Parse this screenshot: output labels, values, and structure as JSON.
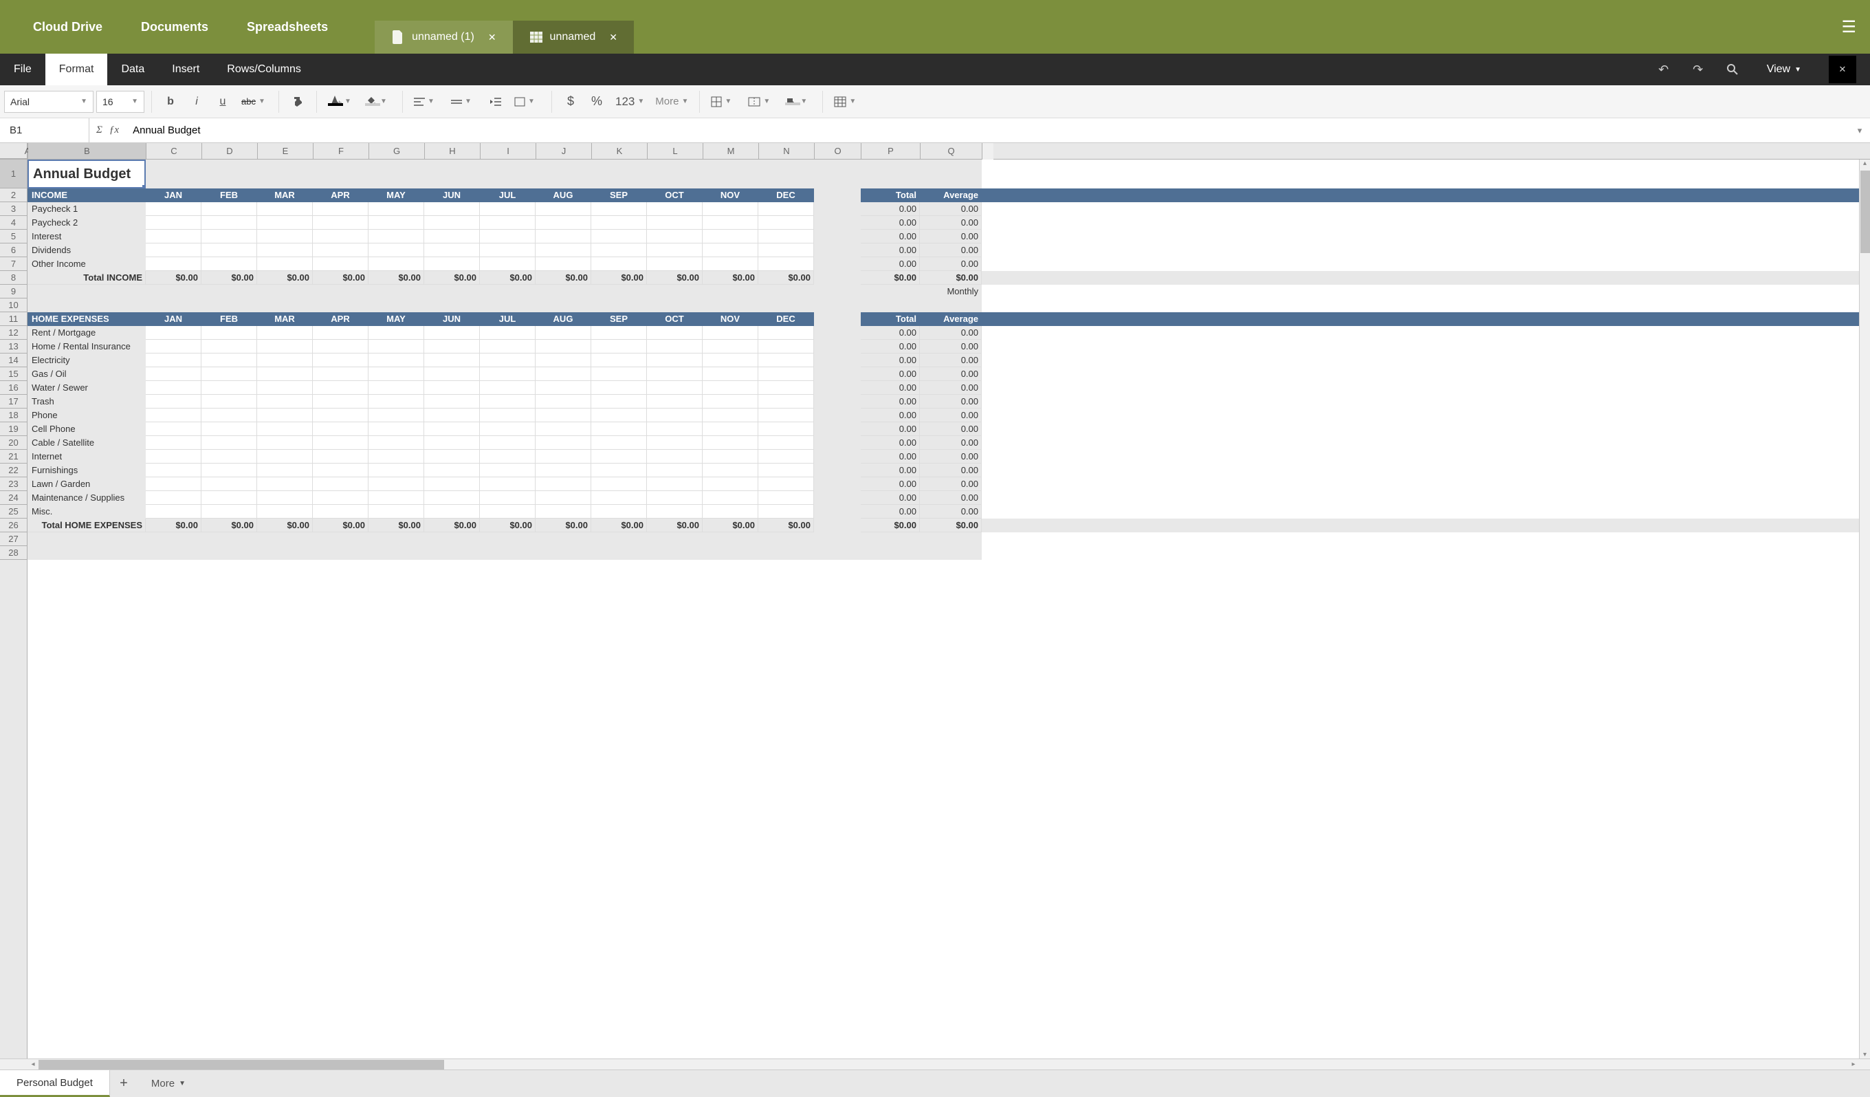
{
  "header": {
    "nav": [
      "Cloud Drive",
      "Documents",
      "Spreadsheets"
    ],
    "tabs": [
      {
        "label": "unnamed (1)",
        "type": "doc",
        "active": false
      },
      {
        "label": "unnamed",
        "type": "sheet",
        "active": true
      }
    ]
  },
  "menubar": {
    "items": [
      "File",
      "Format",
      "Data",
      "Insert",
      "Rows/Columns"
    ],
    "active": "Format",
    "view": "View"
  },
  "toolbar": {
    "font": "Arial",
    "size": "16",
    "num_fmt": "123",
    "more": "More"
  },
  "formula_bar": {
    "cell_ref": "B1",
    "formula": "Annual Budget"
  },
  "columns": [
    "A",
    "B",
    "C",
    "D",
    "E",
    "F",
    "G",
    "H",
    "I",
    "J",
    "K",
    "L",
    "M",
    "N",
    "O",
    "P",
    "Q"
  ],
  "months": [
    "JAN",
    "FEB",
    "MAR",
    "APR",
    "MAY",
    "JUN",
    "JUL",
    "AUG",
    "SEP",
    "OCT",
    "NOV",
    "DEC"
  ],
  "summary_headers": {
    "total": "Total",
    "average": "Average"
  },
  "rows": [
    {
      "n": 1,
      "type": "title",
      "b": "Annual Budget"
    },
    {
      "n": 2,
      "type": "section",
      "b": "INCOME",
      "months": true,
      "summary": true
    },
    {
      "n": 3,
      "type": "item",
      "b": "Paycheck 1",
      "tot": "0.00",
      "avg": "0.00"
    },
    {
      "n": 4,
      "type": "item",
      "b": "Paycheck 2",
      "tot": "0.00",
      "avg": "0.00"
    },
    {
      "n": 5,
      "type": "item",
      "b": "Interest",
      "tot": "0.00",
      "avg": "0.00"
    },
    {
      "n": 6,
      "type": "item",
      "b": "Dividends",
      "tot": "0.00",
      "avg": "0.00"
    },
    {
      "n": 7,
      "type": "item",
      "b": "Other Income",
      "tot": "0.00",
      "avg": "0.00"
    },
    {
      "n": 8,
      "type": "total",
      "b": "Total INCOME",
      "vals": [
        "$0.00",
        "$0.00",
        "$0.00",
        "$0.00",
        "$0.00",
        "$0.00",
        "$0.00",
        "$0.00",
        "$0.00",
        "$0.00",
        "$0.00",
        "$0.00"
      ],
      "tot": "$0.00",
      "avg": "$0.00"
    },
    {
      "n": 9,
      "type": "blank",
      "avg": "Monthly"
    },
    {
      "n": 10,
      "type": "blank"
    },
    {
      "n": 11,
      "type": "section",
      "b": "HOME EXPENSES",
      "months": true,
      "summary": true
    },
    {
      "n": 12,
      "type": "item",
      "b": "Rent / Mortgage",
      "tot": "0.00",
      "avg": "0.00"
    },
    {
      "n": 13,
      "type": "item",
      "b": "Home / Rental Insurance",
      "tot": "0.00",
      "avg": "0.00"
    },
    {
      "n": 14,
      "type": "item",
      "b": "Electricity",
      "tot": "0.00",
      "avg": "0.00"
    },
    {
      "n": 15,
      "type": "item",
      "b": "Gas / Oil",
      "tot": "0.00",
      "avg": "0.00"
    },
    {
      "n": 16,
      "type": "item",
      "b": "Water / Sewer",
      "tot": "0.00",
      "avg": "0.00"
    },
    {
      "n": 17,
      "type": "item",
      "b": "Trash",
      "tot": "0.00",
      "avg": "0.00"
    },
    {
      "n": 18,
      "type": "item",
      "b": "Phone",
      "tot": "0.00",
      "avg": "0.00"
    },
    {
      "n": 19,
      "type": "item",
      "b": "Cell Phone",
      "tot": "0.00",
      "avg": "0.00"
    },
    {
      "n": 20,
      "type": "item",
      "b": "Cable / Satellite",
      "tot": "0.00",
      "avg": "0.00"
    },
    {
      "n": 21,
      "type": "item",
      "b": "Internet",
      "tot": "0.00",
      "avg": "0.00"
    },
    {
      "n": 22,
      "type": "item",
      "b": "Furnishings",
      "tot": "0.00",
      "avg": "0.00"
    },
    {
      "n": 23,
      "type": "item",
      "b": "Lawn / Garden",
      "tot": "0.00",
      "avg": "0.00"
    },
    {
      "n": 24,
      "type": "item",
      "b": "Maintenance / Supplies",
      "tot": "0.00",
      "avg": "0.00"
    },
    {
      "n": 25,
      "type": "item",
      "b": "Misc.",
      "tot": "0.00",
      "avg": "0.00"
    },
    {
      "n": 26,
      "type": "total",
      "b": "Total HOME EXPENSES",
      "vals": [
        "$0.00",
        "$0.00",
        "$0.00",
        "$0.00",
        "$0.00",
        "$0.00",
        "$0.00",
        "$0.00",
        "$0.00",
        "$0.00",
        "$0.00",
        "$0.00"
      ],
      "tot": "$0.00",
      "avg": "$0.00"
    },
    {
      "n": 27,
      "type": "blank"
    },
    {
      "n": 28,
      "type": "blank"
    }
  ],
  "sheet_tabs": {
    "active": "Personal Budget",
    "more": "More"
  }
}
